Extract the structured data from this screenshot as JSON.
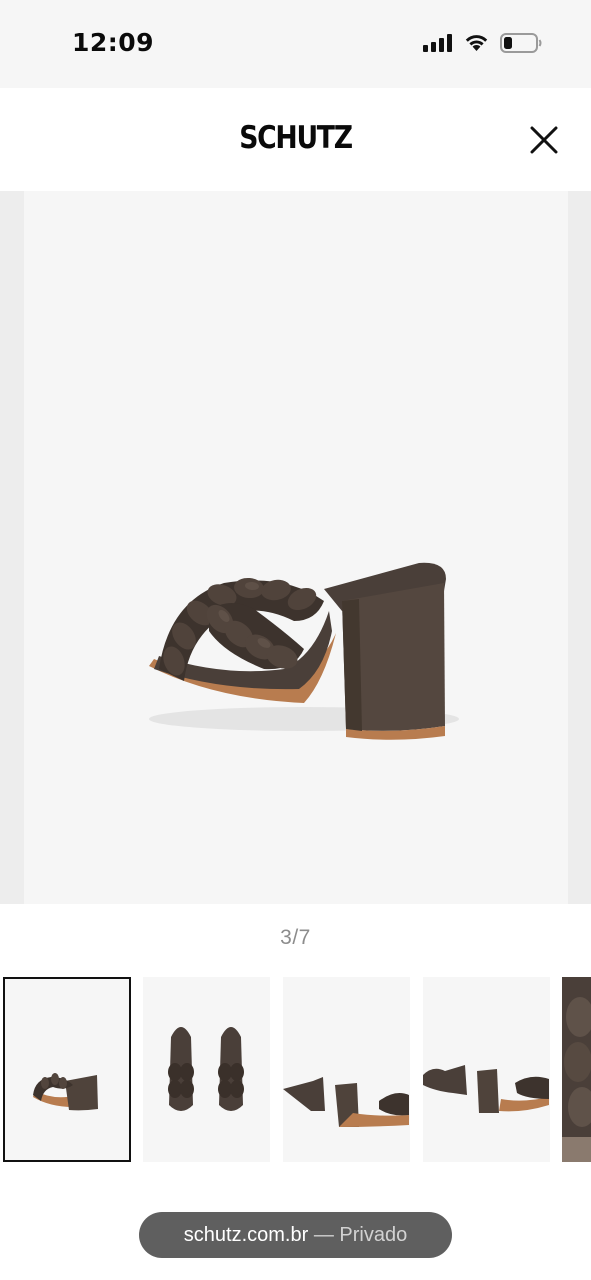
{
  "status_bar": {
    "time": "12:09",
    "icons": [
      "signal-icon",
      "wifi-icon",
      "battery-icon"
    ]
  },
  "header": {
    "brand": "SCHUTZ",
    "close_icon": "close-icon"
  },
  "gallery": {
    "counter": "3/7",
    "current_index": 3,
    "total": 7,
    "thumbnails": [
      {
        "view": "side-rear",
        "selected": true
      },
      {
        "view": "top-pair",
        "selected": false
      },
      {
        "view": "side-pair",
        "selected": false
      },
      {
        "view": "side-pair-reverse",
        "selected": false
      },
      {
        "view": "detail-closeup",
        "selected": false
      }
    ]
  },
  "browser": {
    "url": "schutz.com.br",
    "separator": "—",
    "mode": "Privado"
  },
  "colors": {
    "status_bar_bg": "#f6f6f6",
    "image_bg": "#f6f6f6",
    "shoe_leather": "#4a3f39",
    "sole": "#b87c4f",
    "url_pill": "#5f5f5f",
    "counter_text": "#8c8c8c"
  }
}
